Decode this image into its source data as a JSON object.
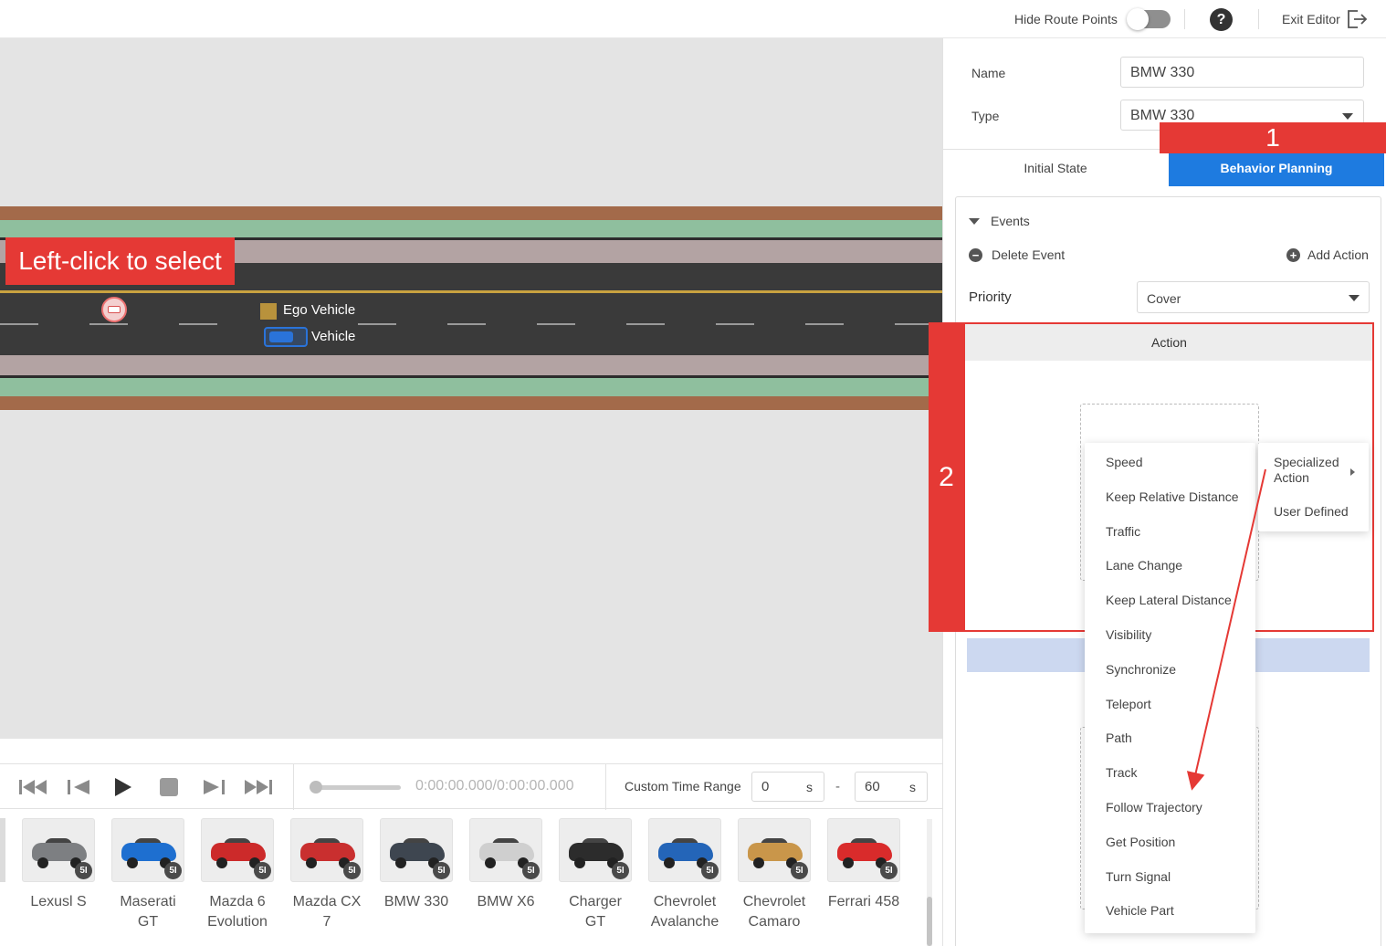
{
  "topbar": {
    "hide_route_points": "Hide Route Points",
    "help": "?",
    "exit_editor": "Exit Editor"
  },
  "scene": {
    "callout": "Left-click to select",
    "ego_label": "Ego Vehicle",
    "vehicle_label": "Vehicle"
  },
  "player": {
    "time": "0:00:00.000/0:00:00.000",
    "custom_time_range": "Custom Time Range",
    "start_value": "0",
    "end_value": "60",
    "unit": "s",
    "dash": "-"
  },
  "library": {
    "vehicles": [
      {
        "name": "Lexusl S",
        "color": "#7d7f82",
        "badge": "5I"
      },
      {
        "name": "Maserati GT",
        "color": "#1e6fd0",
        "badge": "5I"
      },
      {
        "name": "Mazda 6 Evolution",
        "color": "#cc2a2a",
        "badge": "5I"
      },
      {
        "name": "Mazda CX 7",
        "color": "#c92f2f",
        "badge": "5I"
      },
      {
        "name": "BMW 330",
        "color": "#3e4650",
        "badge": "5I"
      },
      {
        "name": "BMW X6",
        "color": "#cfcfcf",
        "badge": "5I"
      },
      {
        "name": "Charger GT",
        "color": "#2c2c2c",
        "badge": "5I"
      },
      {
        "name": "Chevrolet Avalanche",
        "color": "#2465b8",
        "badge": "5I"
      },
      {
        "name": "Chevrolet Camaro",
        "color": "#c9964a",
        "badge": "5I"
      },
      {
        "name": "Ferrari 458",
        "color": "#d92b2b",
        "badge": "5I"
      }
    ]
  },
  "panel": {
    "name_label": "Name",
    "name_value": "BMW 330",
    "type_label": "Type",
    "type_value": "BMW 330",
    "tab_initial": "Initial State",
    "tab_behavior": "Behavior Planning",
    "annotation_1": "1",
    "annotation_2": "2",
    "events_label": "Events",
    "delete_event": "Delete Event",
    "add_action": "Add Action",
    "priority_label": "Priority",
    "priority_value": "Cover",
    "action_header": "Action"
  },
  "menu": {
    "items": [
      "Speed",
      "Keep Relative Distance",
      "Traffic",
      "Lane Change",
      "Keep Lateral Distance",
      "Visibility",
      "Synchronize",
      "Teleport",
      "Path",
      "Track",
      "Follow Trajectory",
      "Get Position",
      "Turn Signal",
      "Vehicle Part"
    ],
    "submenu": {
      "specialized_line1": "Specialized",
      "specialized_line2": "Action",
      "user_defined": "User Defined"
    }
  },
  "colors": {
    "accent_blue": "#1e7be0",
    "annotation_red": "#e53935",
    "road": "#3a3a3a",
    "lane_edge_green": "#8fbf9e",
    "lane_edge_brown": "#a36a4a"
  },
  "icons": [
    "toggle-switch",
    "help-icon",
    "exit-icon",
    "skip-start-icon",
    "step-back-icon",
    "play-icon",
    "stop-icon",
    "step-forward-icon",
    "skip-end-icon",
    "delete-circle-icon",
    "add-circle-icon",
    "caret-down-icon"
  ]
}
